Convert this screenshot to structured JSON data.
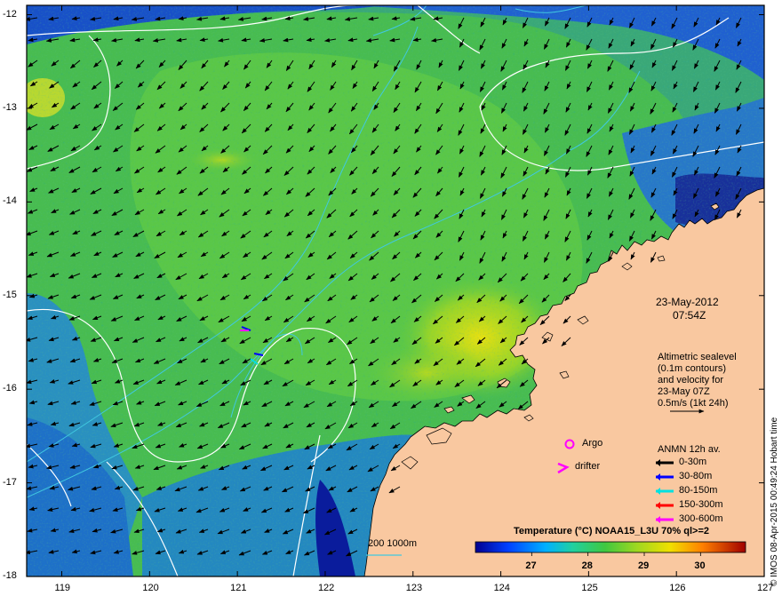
{
  "map": {
    "lon_ticks": [
      "119",
      "120",
      "121",
      "122",
      "123",
      "124",
      "125",
      "126",
      "127"
    ],
    "lat_ticks": [
      "-12",
      "-13",
      "-14",
      "-15",
      "-16",
      "-17",
      "-18"
    ],
    "lon_range": [
      118.6,
      127.0
    ],
    "lat_range": [
      -18.0,
      -11.9
    ],
    "colors": {
      "land": "#f9c8a0",
      "frame": "#000000",
      "isobath": "#40c8e0",
      "sealevel_contour": "#ffffff"
    }
  },
  "timestamp": {
    "date": "23-May-2012",
    "time": "07:54Z"
  },
  "altimetry_note": [
    "Altimetric sealevel",
    "(0.1m contours)",
    "and velocity for",
    "23-May 07Z",
    "0.5m/s (1kt 24h)"
  ],
  "platforms": {
    "argo": "Argo",
    "drifter": "drifter"
  },
  "anmn_legend": {
    "title": "ANMN 12h av.",
    "items": [
      {
        "label": "0-30m",
        "color": "#000000"
      },
      {
        "label": "30-80m",
        "color": "#0000ff"
      },
      {
        "label": "80-150m",
        "color": "#00e0e0"
      },
      {
        "label": "150-300m",
        "color": "#ff0000"
      },
      {
        "label": "300-600m",
        "color": "#ff00ff"
      }
    ]
  },
  "colorbar": {
    "title": "Temperature (°C) NOAA15_L3U 70% ql>=2",
    "ticks": [
      "27",
      "28",
      "29",
      "30"
    ],
    "range": [
      26.0,
      30.8
    ]
  },
  "isobath_legend": "200  1000m",
  "credit": "© IMOS 08-Apr-2015 00:49:24 Hobart time"
}
